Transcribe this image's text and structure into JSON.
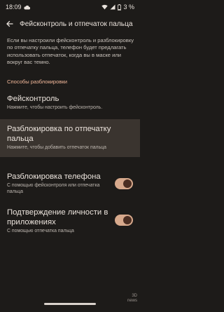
{
  "status": {
    "time": "18:09",
    "cloud_icon": "cloud-icon",
    "wifi_icon": "wifi-icon",
    "signal_icon": "signal-icon",
    "battery_icon": "battery-icon",
    "battery_percent": "3 %"
  },
  "header": {
    "back_icon": "arrow-back-icon",
    "title": "Фейсконтроль и отпечаток пальца"
  },
  "description": "Если вы настроили фейсконтроль и разблокировку по отпечатку пальца, телефон будет предлагать использовать отпечаток, когда вы в маске или вокруг вас темно.",
  "section": {
    "header": "Способы разблокировки"
  },
  "items": [
    {
      "title": "Фейсконтроль",
      "subtitle": "Нажмите, чтобы настроить фейсконтроль."
    },
    {
      "title": "Разблокировка по отпечатку пальца",
      "subtitle": "Нажмите, чтобы добавить отпечаток пальца"
    },
    {
      "title": "Разблокировка телефона",
      "subtitle": "С помощью фейсконтроля или отпечатка пальца",
      "toggle_on": true
    },
    {
      "title": "Подтверждение личности в приложениях",
      "subtitle": "С помощью отпечатка пальца",
      "toggle_on": true
    }
  ],
  "watermark": {
    "line1": "3D",
    "line2": "news"
  },
  "colors": {
    "background": "#1d1b19",
    "accent": "#f2b89a",
    "toggle_track": "#d7a98c",
    "selected_row": "#3a342f"
  }
}
